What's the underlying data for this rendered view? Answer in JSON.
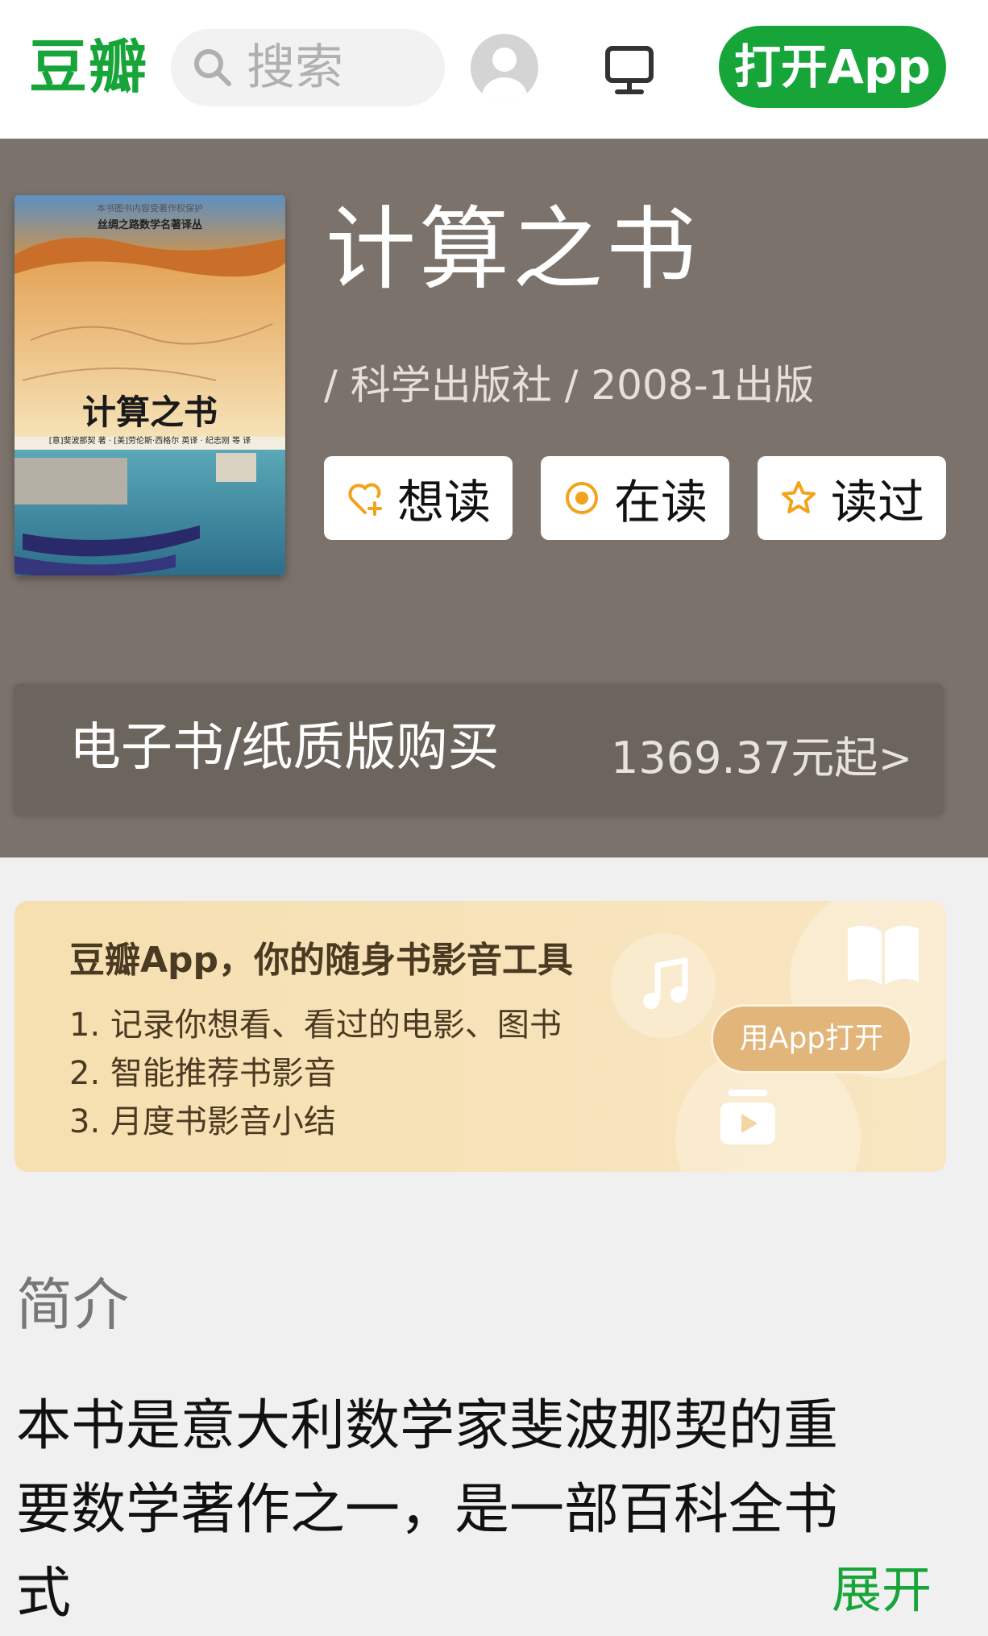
{
  "header": {
    "logo": "豆瓣",
    "search_placeholder": "搜索",
    "open_app": "打开App"
  },
  "book": {
    "title": "计算之书",
    "meta": "/ 科学出版社 / 2008-1出版",
    "cover": {
      "series": "丝绸之路数学名著译丛",
      "top_line": "本书图书内容受著作权保护",
      "title": "计算之书",
      "authors": "[意]斐波那契 著 · [美]劳伦斯·西格尔 英译 · 纪志刚 等 译"
    }
  },
  "actions": [
    {
      "label": "想读",
      "icon": "heart-plus-icon"
    },
    {
      "label": "在读",
      "icon": "target-icon"
    },
    {
      "label": "读过",
      "icon": "star-icon"
    }
  ],
  "buy": {
    "label": "电子书/纸质版购买",
    "price": "1369.37元起",
    "chevron": ">"
  },
  "promo": {
    "title": "豆瓣App，你的随身书影音工具",
    "items": [
      "1. 记录你想看、看过的电影、图书",
      "2. 智能推荐书影音",
      "3. 月度书影音小结"
    ],
    "button": "用App打开"
  },
  "intro": {
    "heading": "简介",
    "lines": [
      "本书是意大利数学家斐波那契的重",
      "要数学著作之一，是一部百科全书",
      "式"
    ],
    "expand": "展开"
  },
  "colors": {
    "brand_green": "#17a53a",
    "hero_bg": "#7b736b",
    "action_orange": "#f2a21c"
  }
}
